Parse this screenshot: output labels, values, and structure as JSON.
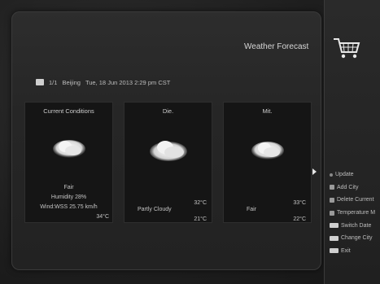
{
  "header": {
    "title": "Weather Forecast"
  },
  "location": {
    "page": "1/1",
    "city": "Beijing",
    "datetime": "Tue, 18 Jun 2013 2:29 pm CST"
  },
  "current": {
    "title": "Current Conditions",
    "condition": "Fair",
    "humidity": "Humidity 28%",
    "wind": "Wind:WSS 25.75 km/h",
    "temp": "34°C"
  },
  "forecast": [
    {
      "day": "Die.",
      "condition": "Partly Cloudy",
      "high": "32°C",
      "low": "21°C"
    },
    {
      "day": "Mit.",
      "condition": "Fair",
      "high": "33°C",
      "low": "22°C"
    }
  ],
  "menu": {
    "items": [
      {
        "label": "Update",
        "icon": "dot-icon"
      },
      {
        "label": "Add City",
        "icon": "red-key-icon"
      },
      {
        "label": "Delete Current",
        "icon": "green-key-icon"
      },
      {
        "label": "Temperature M",
        "icon": "yellow-key-icon"
      },
      {
        "label": "Switch Date",
        "icon": "left-right-key-icon"
      },
      {
        "label": "Change City",
        "icon": "up-down-key-icon"
      },
      {
        "label": "Exit",
        "icon": "exit-key-icon"
      }
    ]
  }
}
